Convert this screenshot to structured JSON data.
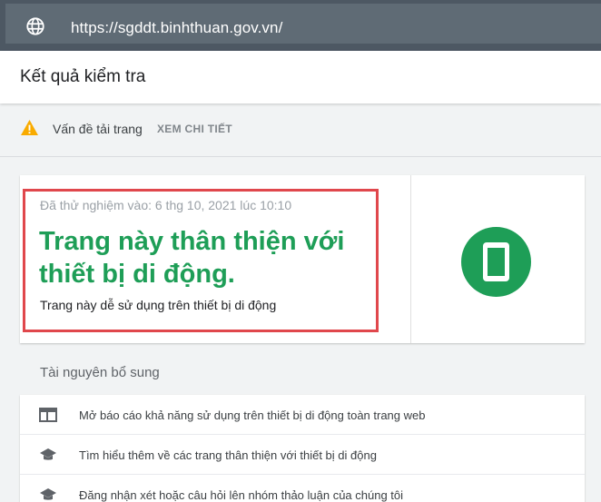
{
  "url_bar": {
    "url": "https://sgddt.binhthuan.gov.vn/",
    "icon": "globe-icon"
  },
  "header": {
    "title": "Kết quả kiểm tra"
  },
  "issue": {
    "icon": "warning-icon",
    "label": "Vấn đề tải trang",
    "action": "XEM CHI TIẾT",
    "icon_color": "#f9ab00"
  },
  "result": {
    "tested_date": "Đã thử nghiệm vào: 6 thg 10, 2021 lúc 10:10",
    "title": "Trang này thân thiện với thiết bị di động.",
    "subtitle": "Trang này dễ sử dụng trên thiết bị di động",
    "icon": "mobile-phone-icon",
    "accent": "#1e9e57",
    "highlight_color": "#e0474c"
  },
  "resources": {
    "title": "Tài nguyên bổ sung",
    "items": [
      {
        "icon": "web-report-icon",
        "label": "Mở báo cáo khả năng sử dụng trên thiết bị di động toàn trang web"
      },
      {
        "icon": "graduation-cap-icon",
        "label": "Tìm hiểu thêm về các trang thân thiện với thiết bị di động"
      },
      {
        "icon": "graduation-cap-icon",
        "label": "Đăng nhận xét hoặc câu hỏi lên nhóm thảo luận của chúng tôi"
      }
    ]
  }
}
